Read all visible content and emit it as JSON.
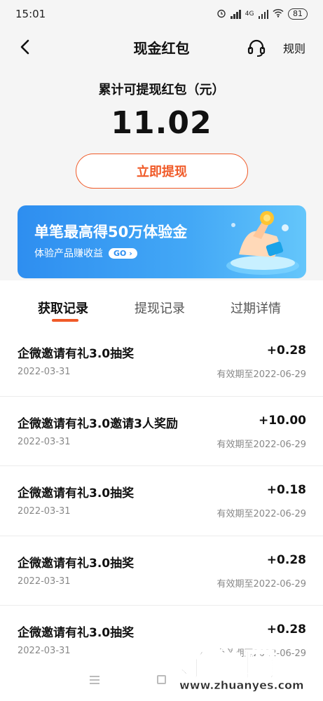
{
  "status_bar": {
    "time": "15:01",
    "network": "4G",
    "battery": "81"
  },
  "nav": {
    "title": "现金红包",
    "rules_label": "规则"
  },
  "summary": {
    "label": "累计可提现红包（元）",
    "amount": "11.02",
    "withdraw_label": "立即提现"
  },
  "banner": {
    "title": "单笔最高得50万体验金",
    "subtitle": "体验产品赚收益",
    "go_label": "GO"
  },
  "tabs": [
    {
      "label": "获取记录",
      "active": true
    },
    {
      "label": "提现记录",
      "active": false
    },
    {
      "label": "过期详情",
      "active": false
    }
  ],
  "records": [
    {
      "title": "企微邀请有礼3.0抽奖",
      "date": "2022-03-31",
      "amount": "+0.28",
      "expire": "有效期至2022-06-29"
    },
    {
      "title": "企微邀请有礼3.0邀请3人奖励",
      "date": "2022-03-31",
      "amount": "+10.00",
      "expire": "有效期至2022-06-29"
    },
    {
      "title": "企微邀请有礼3.0抽奖",
      "date": "2022-03-31",
      "amount": "+0.18",
      "expire": "有效期至2022-06-29"
    },
    {
      "title": "企微邀请有礼3.0抽奖",
      "date": "2022-03-31",
      "amount": "+0.28",
      "expire": "有效期至2022-06-29"
    },
    {
      "title": "企微邀请有礼3.0抽奖",
      "date": "2022-03-31",
      "amount": "+0.28",
      "expire": "有效期至2022-06-29"
    }
  ],
  "watermark": {
    "main": "好赚网",
    "url": "www.zhuanyes.com"
  },
  "colors": {
    "accent": "#f05a28",
    "banner": "#3a9af3",
    "background": "#f5f5f5"
  }
}
